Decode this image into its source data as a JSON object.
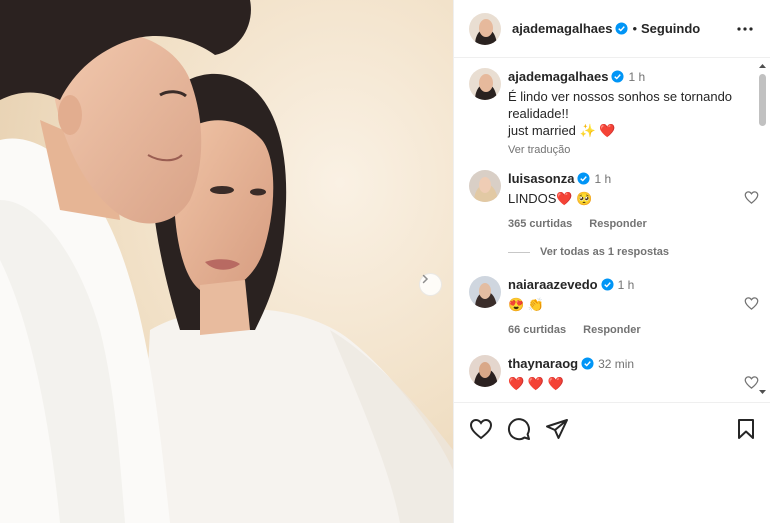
{
  "post": {
    "author": "ajademagalhaes",
    "follow_status": "Seguindo",
    "separator": "•",
    "caption": {
      "time": "1 h",
      "lines": [
        "É lindo ver nossos sonhos se tornando",
        "realidade!!",
        "just married ✨ ❤️"
      ],
      "translate_label": "Ver tradução"
    }
  },
  "comments": [
    {
      "user": "luisasonza",
      "time": "1 h",
      "text": "LINDOS❤️ 🥺",
      "likes": "365 curtidas",
      "reply": "Responder"
    },
    {
      "user": "naiaraazevedo",
      "time": "1 h",
      "text": "😍 👏",
      "likes": "66 curtidas",
      "reply": "Responder"
    },
    {
      "user": "thaynaraog",
      "time": "32 min",
      "text": "❤️ ❤️ ❤️"
    }
  ],
  "view_replies_label": "Ver todas as 1 respostas",
  "icons": {
    "verified": "verified-badge-icon",
    "more": "more-options-icon",
    "next": "chevron-right-icon",
    "like": "heart-icon",
    "comment": "comment-icon",
    "share": "share-icon",
    "save": "bookmark-icon"
  },
  "colors": {
    "verified": "#0095f6",
    "heart": "#ed4956",
    "muted": "#737373"
  }
}
